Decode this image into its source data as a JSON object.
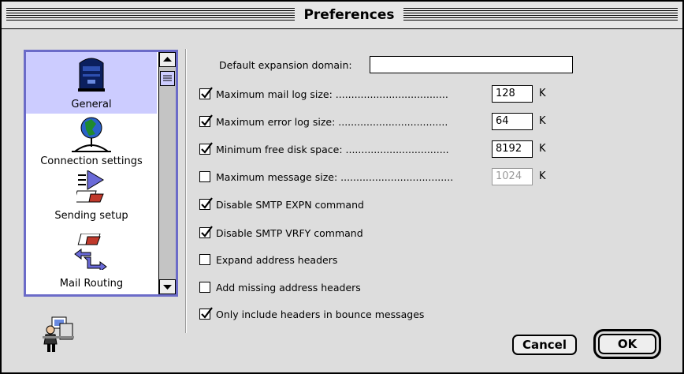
{
  "window": {
    "title": "Preferences"
  },
  "sidebar": {
    "items": [
      {
        "label": "General",
        "icon": "mailbox-icon",
        "selected": true
      },
      {
        "label": "Connection settings",
        "icon": "globe-network-icon",
        "selected": false
      },
      {
        "label": "Sending setup",
        "icon": "send-arrow-icon",
        "selected": false
      },
      {
        "label": "Mail Routing",
        "icon": "routing-arrows-icon",
        "selected": false
      }
    ]
  },
  "form": {
    "default_domain": {
      "label": "Default expansion domain:",
      "value": ""
    },
    "fields": [
      {
        "label": "Maximum mail log size: ....................................",
        "value": "128",
        "unit": "K",
        "checked": true,
        "enabled": true
      },
      {
        "label": "Maximum error log size: ...................................",
        "value": "64",
        "unit": "K",
        "checked": true,
        "enabled": true
      },
      {
        "label": "Minimum free disk space: .................................",
        "value": "8192",
        "unit": "K",
        "checked": true,
        "enabled": true
      },
      {
        "label": "Maximum message size: ....................................",
        "value": "1024",
        "unit": "K",
        "checked": false,
        "enabled": false
      }
    ],
    "options": [
      {
        "label": "Disable SMTP EXPN command",
        "checked": true
      },
      {
        "label": "Disable SMTP VRFY command",
        "checked": true
      },
      {
        "label": "Expand address headers",
        "checked": false
      },
      {
        "label": "Add missing address headers",
        "checked": false
      },
      {
        "label": "Only include headers in bounce messages",
        "checked": true
      }
    ]
  },
  "buttons": {
    "cancel": "Cancel",
    "ok": "OK"
  },
  "colors": {
    "selection": "#ccccff",
    "list_border": "#6b6bc8",
    "window_bg": "#dddddd"
  }
}
